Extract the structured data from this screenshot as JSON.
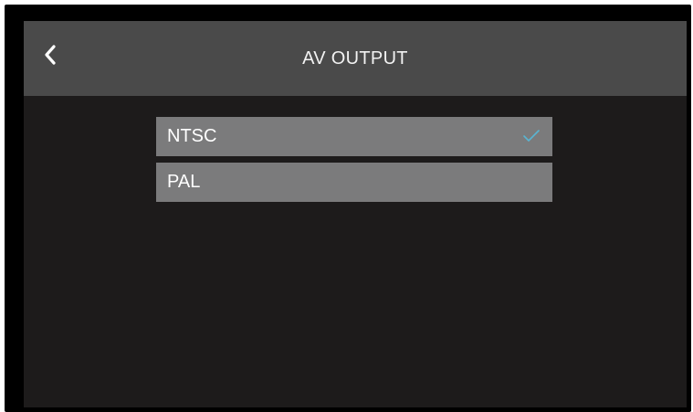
{
  "header": {
    "title": "AV OUTPUT",
    "back_icon": "chevron-left-icon"
  },
  "options": [
    {
      "label": "NTSC",
      "selected": true
    },
    {
      "label": "PAL",
      "selected": false
    }
  ],
  "colors": {
    "header_bg": "#4a4a4a",
    "screen_bg": "#1d1b1b",
    "option_bg": "#7b7b7c",
    "check": "#5ab4d2"
  }
}
